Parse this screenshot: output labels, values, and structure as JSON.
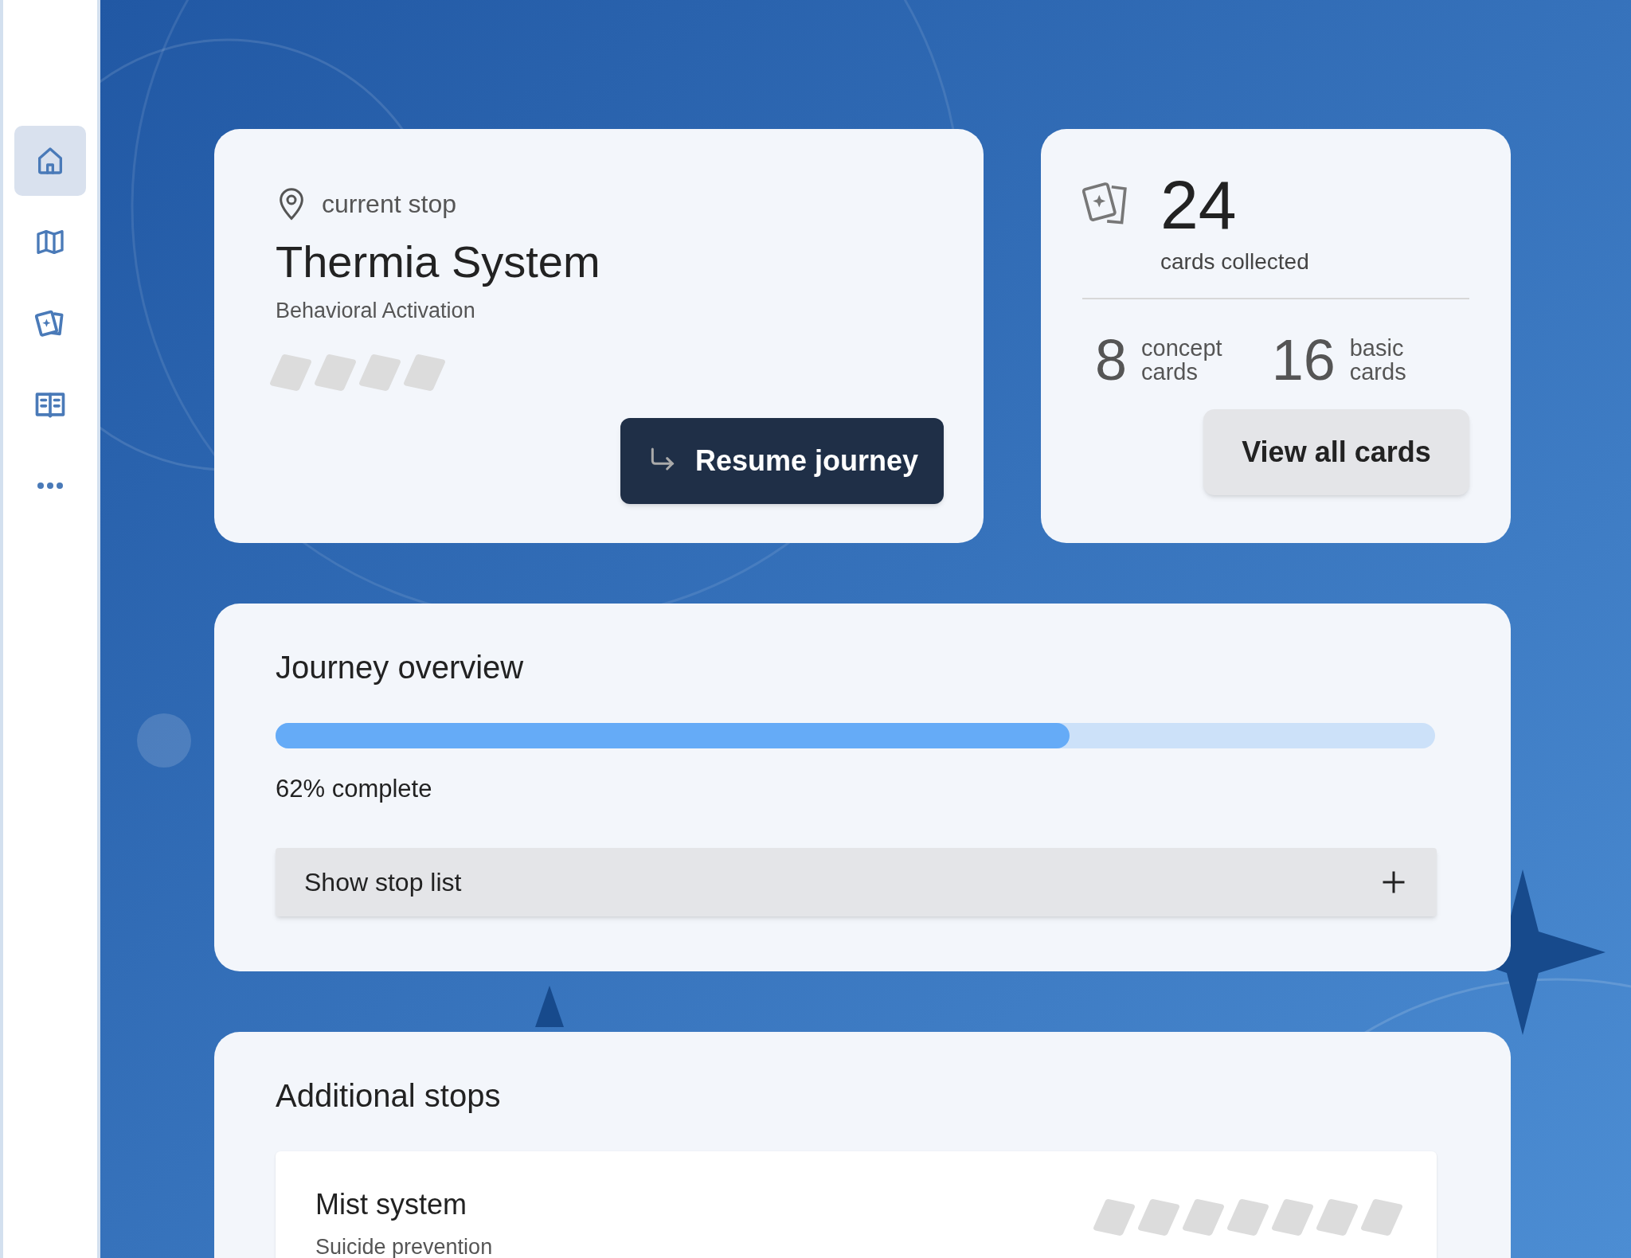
{
  "sidebar": {
    "items": [
      {
        "kind": "home",
        "selected": true
      },
      {
        "kind": "map",
        "selected": false
      },
      {
        "kind": "cards",
        "selected": false
      },
      {
        "kind": "book",
        "selected": false
      },
      {
        "kind": "more",
        "selected": false
      }
    ]
  },
  "current_stop": {
    "label": "current stop",
    "title": "Thermia System",
    "subtitle": "Behavioral Activation",
    "slots": [
      {
        "collected": false
      },
      {
        "collected": false
      },
      {
        "collected": false
      },
      {
        "collected": false
      }
    ],
    "button": "Resume journey"
  },
  "cards": {
    "total": "24",
    "total_label": "cards collected",
    "breakdown": [
      {
        "count": "8",
        "label_1": "concept",
        "label_2": "cards"
      },
      {
        "count": "16",
        "label_1": "basic",
        "label_2": "cards"
      }
    ],
    "button": "View all cards"
  },
  "overview": {
    "title": "Journey overview",
    "level": 0.685,
    "progress_text": "62% complete",
    "toggle": {
      "label": "Show stop list",
      "expanded": false
    }
  },
  "additional": {
    "title": "Additional stops",
    "stops": [
      {
        "title": "Mist system",
        "subtitle": "Suicide prevention",
        "slots": [
          {
            "collected": false
          },
          {
            "collected": false
          },
          {
            "collected": false
          },
          {
            "collected": false
          },
          {
            "collected": false
          },
          {
            "collected": false
          },
          {
            "collected": false
          }
        ]
      }
    ]
  }
}
